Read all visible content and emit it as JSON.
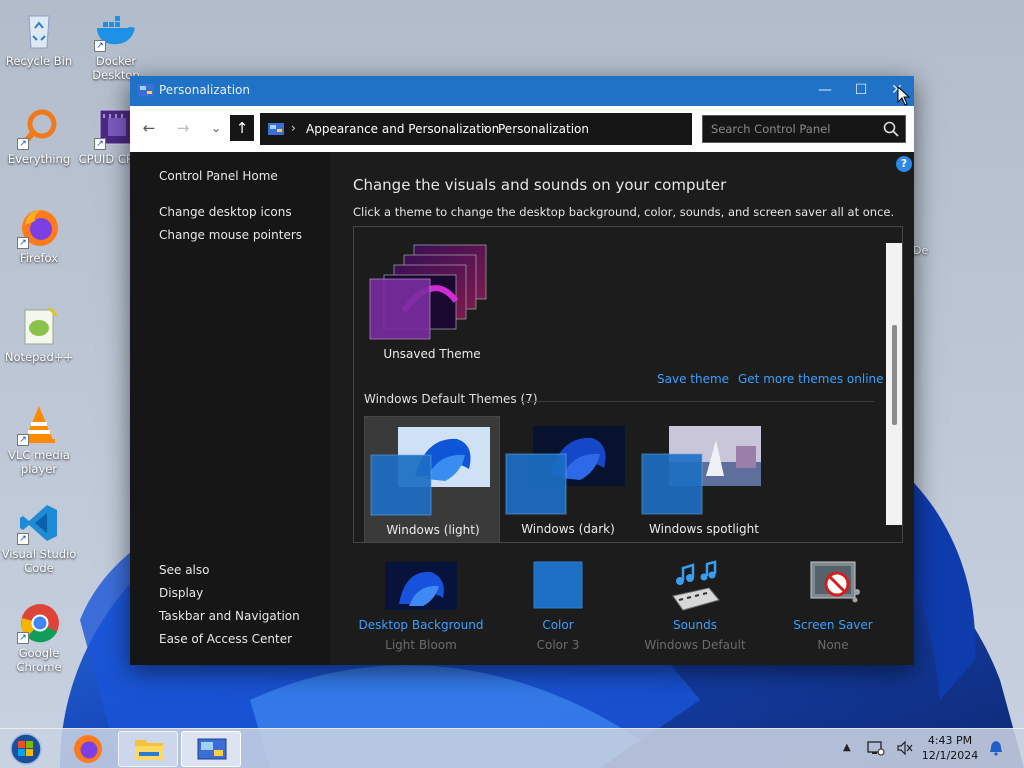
{
  "desktop": {
    "icons": [
      {
        "label": "Recycle Bin",
        "icon": "recycle-bin-icon"
      },
      {
        "label": "Docker Desktop",
        "icon": "docker-icon"
      },
      {
        "label": "Everything",
        "icon": "everything-search-icon"
      },
      {
        "label": "CPUID CPU-Z",
        "icon": "cpuid-icon"
      },
      {
        "label": "Firefox",
        "icon": "firefox-icon"
      },
      {
        "label": "Notepad++",
        "icon": "notepadpp-icon"
      },
      {
        "label": "VLC media player",
        "icon": "vlc-icon"
      },
      {
        "label": "Visual Studio Code",
        "icon": "vscode-icon"
      },
      {
        "label": "Google Chrome",
        "icon": "chrome-icon"
      }
    ],
    "partial_text": "De"
  },
  "window": {
    "title": "Personalization",
    "controls": {
      "minimize": "—",
      "maximize": "☐",
      "close": "✕"
    },
    "address": {
      "back": "←",
      "forward": "→",
      "recent": "⌄",
      "up": "↑",
      "crumbs": [
        "Appearance and Personalization",
        "Personalization"
      ],
      "separator": "›",
      "dropdown": "⌄",
      "refresh": "↻"
    },
    "search": {
      "placeholder": "Search Control Panel"
    },
    "help": "?"
  },
  "left_nav": {
    "home": "Control Panel Home",
    "links": [
      "Change desktop icons",
      "Change mouse pointers"
    ],
    "see_also_title": "See also",
    "see_also": [
      "Display",
      "Taskbar and Navigation",
      "Ease of Access Center"
    ]
  },
  "main": {
    "title": "Change the visuals and sounds on your computer",
    "subtitle": "Click a theme to change the desktop background, color, sounds, and screen saver all at once.",
    "my_themes": [
      {
        "name": "Unsaved Theme"
      }
    ],
    "actions": {
      "save": "Save theme",
      "more": "Get more themes online"
    },
    "default_group": "Windows Default Themes (7)",
    "default_themes": [
      {
        "name": "Windows (light)",
        "selected": true
      },
      {
        "name": "Windows (dark)",
        "selected": false
      },
      {
        "name": "Windows spotlight",
        "selected": false
      }
    ],
    "scroll_position": 0.45
  },
  "bottom": [
    {
      "name": "Desktop Background",
      "value": "Light Bloom"
    },
    {
      "name": "Color",
      "value": "Color 3"
    },
    {
      "name": "Sounds",
      "value": "Windows Default"
    },
    {
      "name": "Screen Saver",
      "value": "None"
    }
  ],
  "taskbar": {
    "time": "4:43 PM",
    "date": "12/1/2024",
    "apps": [
      "start-orb-icon",
      "firefox-icon",
      "file-explorer-icon",
      "control-panel-icon"
    ],
    "tray": [
      "show-hidden-icons-chevron",
      "network-icon",
      "volume-muted-icon",
      "notification-bell-icon"
    ]
  },
  "colors": {
    "accent_blue": "#1f72c5",
    "link_blue": "#3aa0ff",
    "window_bg": "#1c1c1c",
    "nav_bg": "#161616"
  }
}
